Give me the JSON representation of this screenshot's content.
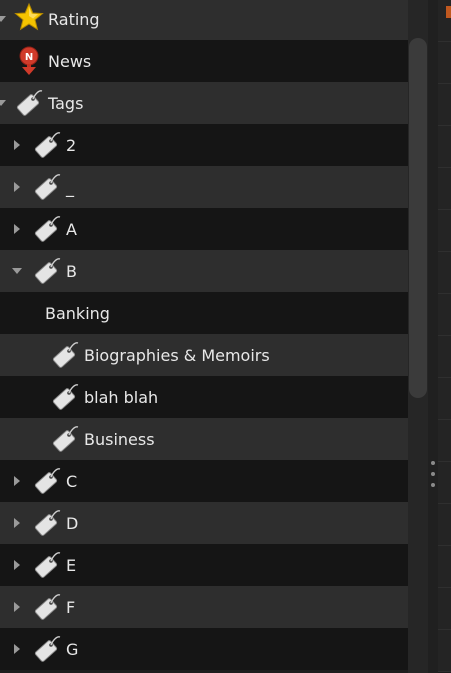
{
  "sidebar": {
    "items": [
      {
        "label": "Rating",
        "icon": "star-icon",
        "expander": "down",
        "level": 0
      },
      {
        "label": "News",
        "icon": "news-pin-icon",
        "expander": "none",
        "level": 0
      },
      {
        "label": "Tags",
        "icon": "tag-icon",
        "expander": "down",
        "level": 0
      },
      {
        "label": "2",
        "icon": "tag-icon",
        "expander": "right",
        "level": 1
      },
      {
        "label": "_",
        "icon": "tag-icon",
        "expander": "right",
        "level": 1
      },
      {
        "label": "A",
        "icon": "tag-icon",
        "expander": "right",
        "level": 1
      },
      {
        "label": "B",
        "icon": "tag-icon",
        "expander": "down",
        "level": 1
      },
      {
        "label": "Banking",
        "icon": "",
        "expander": "none",
        "level": 2
      },
      {
        "label": "Biographies & Memoirs",
        "icon": "tag-icon",
        "expander": "none",
        "level": 2
      },
      {
        "label": "blah blah",
        "icon": "tag-icon",
        "expander": "none",
        "level": 2
      },
      {
        "label": "Business",
        "icon": "tag-icon",
        "expander": "none",
        "level": 2
      },
      {
        "label": "C",
        "icon": "tag-icon",
        "expander": "right",
        "level": 1
      },
      {
        "label": "D",
        "icon": "tag-icon",
        "expander": "right",
        "level": 1
      },
      {
        "label": "E",
        "icon": "tag-icon",
        "expander": "right",
        "level": 1
      },
      {
        "label": "F",
        "icon": "tag-icon",
        "expander": "right",
        "level": 1
      },
      {
        "label": "G",
        "icon": "tag-icon",
        "expander": "right",
        "level": 1
      }
    ]
  },
  "colors": {
    "row_light": "#2e2e2e",
    "row_dark": "#151515",
    "text": "#e8e8e8",
    "star": "#f5c400",
    "news_badge": "#d03a2a"
  }
}
